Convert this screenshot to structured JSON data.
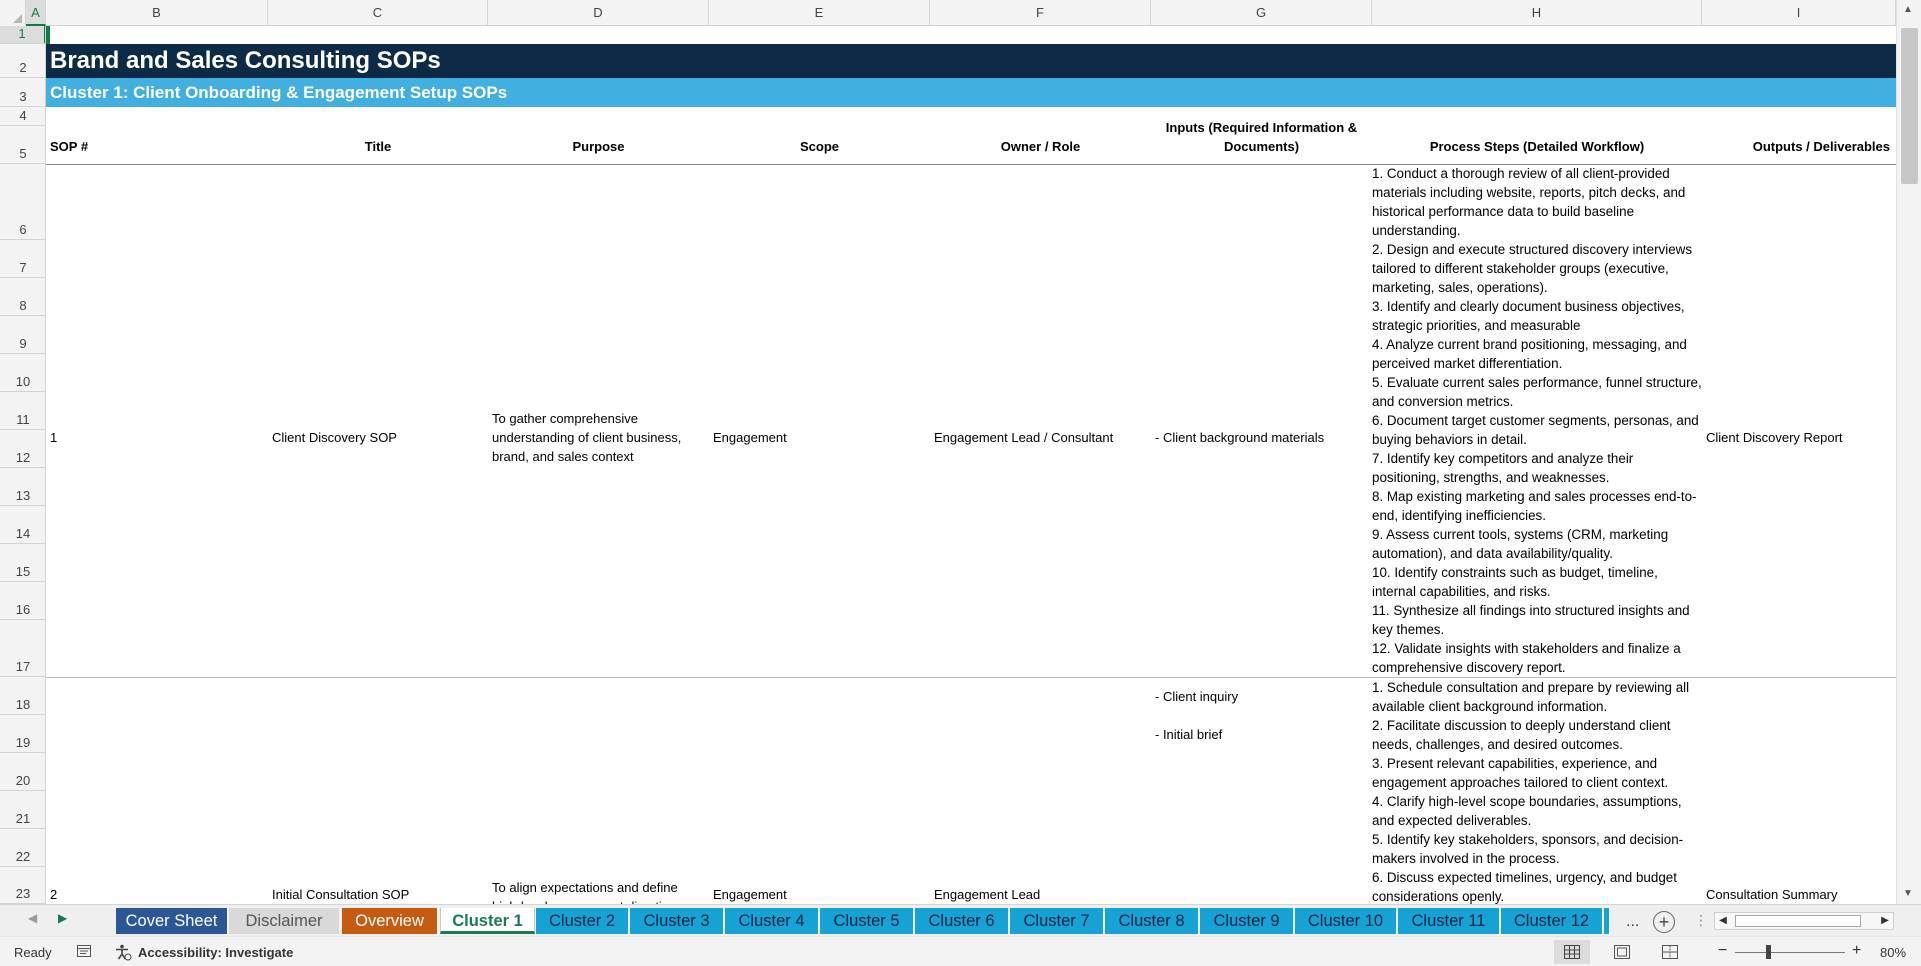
{
  "columns": [
    "A",
    "B",
    "C",
    "D",
    "E",
    "F",
    "G",
    "H",
    "I"
  ],
  "selected_column": "A",
  "rows": [
    "1",
    "2",
    "3",
    "4",
    "5",
    "6",
    "7",
    "8",
    "9",
    "10",
    "11",
    "12",
    "13",
    "14",
    "15",
    "16",
    "17",
    "18",
    "19",
    "20",
    "21",
    "22",
    "23"
  ],
  "selected_row": "1",
  "sheet": {
    "title": "Brand and Sales Consulting SOPs",
    "cluster_heading": "Cluster 1: Client Onboarding & Engagement Setup SOPs",
    "headers": {
      "sop": "SOP #",
      "title": "Title",
      "purpose": "Purpose",
      "scope": "Scope",
      "owner": "Owner / Role",
      "inputs": "Inputs (Required Information & Documents)",
      "steps": "Process Steps (Detailed Workflow)",
      "outputs": "Outputs / Deliverables"
    },
    "records": [
      {
        "sop": "1",
        "title": "Client Discovery SOP",
        "purpose": "To gather comprehensive understanding of client business, brand, and sales context",
        "scope": "Engagement",
        "owner": "Engagement Lead / Consultant",
        "inputs": [
          "- Client background materials"
        ],
        "steps": [
          "1. Conduct a thorough review of all client-provided materials including website, reports, pitch decks, and historical performance data to build baseline understanding.",
          "2. Design and execute structured discovery interviews tailored to different stakeholder groups (executive, marketing, sales, operations).",
          "3. Identify and clearly document business objectives, strategic priorities, and measurable",
          "4. Analyze current brand positioning, messaging, and perceived market differentiation.",
          "5. Evaluate current sales performance, funnel structure, and conversion metrics.",
          "6. Document target customer segments, personas, and buying behaviors in detail.",
          "7. Identify key competitors and analyze their positioning, strengths, and weaknesses.",
          "8. Map existing marketing and sales processes end-to-end, identifying inefficiencies.",
          "9. Assess current tools, systems (CRM, marketing automation), and data availability/quality.",
          "10. Identify constraints such as budget, timeline, internal capabilities, and risks.",
          "11. Synthesize all findings into structured insights and key themes.",
          "12. Validate insights with stakeholders and finalize a comprehensive discovery report."
        ],
        "outputs": "Client Discovery Report"
      },
      {
        "sop": "2",
        "title": "Initial Consultation SOP",
        "purpose": "To align expectations and define high-level engagement direction",
        "scope": "Engagement",
        "owner": "Engagement Lead",
        "inputs": [
          "- Client inquiry",
          "- Initial brief"
        ],
        "steps": [
          "1. Schedule consultation and prepare by reviewing all available client background information.",
          "2. Facilitate discussion to deeply understand client needs, challenges, and desired outcomes.",
          "3. Present relevant capabilities, experience, and engagement approaches tailored to client context.",
          "4. Clarify high-level scope boundaries, assumptions, and expected deliverables.",
          "5. Identify key stakeholders, sponsors, and decision-makers involved in the process.",
          "6. Discuss expected timelines, urgency, and budget considerations openly."
        ],
        "outputs": "Consultation Summary"
      }
    ]
  },
  "tabs": [
    {
      "label": "Cover Sheet",
      "kind": "cover"
    },
    {
      "label": "Disclaimer",
      "kind": "disclaimer"
    },
    {
      "label": "Overview",
      "kind": "overview"
    },
    {
      "label": "Cluster 1",
      "kind": "active"
    },
    {
      "label": "Cluster 2",
      "kind": "cluster"
    },
    {
      "label": "Cluster 3",
      "kind": "cluster"
    },
    {
      "label": "Cluster 4",
      "kind": "cluster"
    },
    {
      "label": "Cluster 5",
      "kind": "cluster"
    },
    {
      "label": "Cluster 6",
      "kind": "cluster"
    },
    {
      "label": "Cluster 7",
      "kind": "cluster"
    },
    {
      "label": "Cluster 8",
      "kind": "cluster"
    },
    {
      "label": "Cluster 9",
      "kind": "cluster"
    },
    {
      "label": "Cluster 10",
      "kind": "cluster"
    },
    {
      "label": "Cluster 11",
      "kind": "cluster"
    },
    {
      "label": "Cluster 12",
      "kind": "cluster"
    }
  ],
  "tab_more": "...",
  "status": {
    "ready": "Ready",
    "accessibility": "Accessibility: Investigate",
    "zoom": "80%",
    "zoom_minus": "−",
    "zoom_plus": "+"
  },
  "icons": {
    "nav_prev": "triangle-left-icon",
    "nav_next": "triangle-right-icon",
    "add_sheet": "plus-circle-icon",
    "macro": "macro-record-icon",
    "accessibility": "accessibility-icon",
    "normal_view": "normal-view-icon",
    "page_layout": "page-layout-view-icon",
    "page_break": "page-break-view-icon"
  },
  "colors": {
    "title_band": "#0d2a47",
    "cluster_band": "#41b0e0",
    "tab_cover": "#2b5797",
    "tab_overview": "#c55a11",
    "tab_cluster": "#17a2d6",
    "excel_green": "#107c41"
  }
}
